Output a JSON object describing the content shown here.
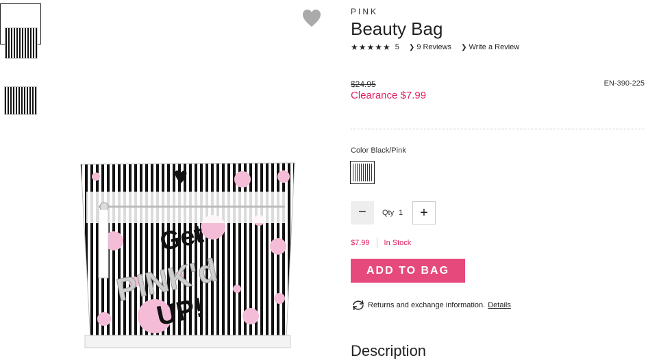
{
  "thumbnails": [
    {
      "name": "thumb-1"
    },
    {
      "name": "thumb-2"
    }
  ],
  "product": {
    "brand": "PINK",
    "title": "Beauty Bag",
    "stars": "★★★★★",
    "rating_value": "5",
    "reviews_link": "9 Reviews",
    "write_review_link": "Write a Review",
    "was_price": "$24.95",
    "clearance_price": "Clearance $7.99",
    "sku": "EN-390-225",
    "color_label": "Color Black/Pink",
    "qty_label": "Qty",
    "qty_value": "1",
    "price": "$7.99",
    "stock_status": "In Stock",
    "add_to_bag": "ADD TO BAG",
    "returns_text": "Returns and exchange information.",
    "returns_link": "Details",
    "description_heading": "Description",
    "image_text": [
      "Get",
      "PINK'd",
      "UP!"
    ]
  },
  "icons": {
    "wishlist": "heart-icon",
    "chevron": "chevron-right-icon",
    "returns": "exchange-icon",
    "minus": "minus-icon",
    "plus": "plus-icon"
  },
  "colors": {
    "accent": "#e0205e",
    "button": "#e6497c",
    "heart": "#aaaaaa"
  }
}
